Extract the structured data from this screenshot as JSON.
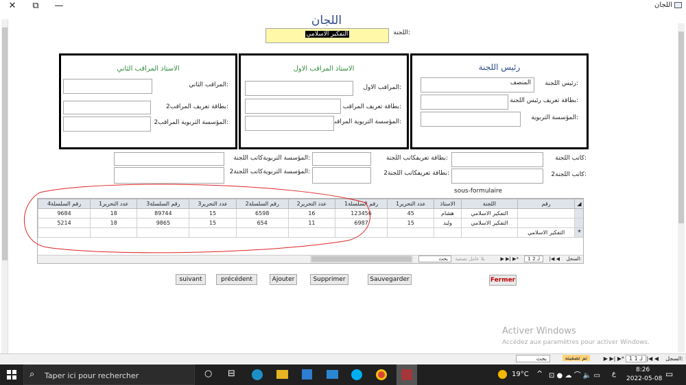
{
  "window": {
    "title": "اللجان",
    "close": "✕",
    "restore": "⧉",
    "minimize": "—"
  },
  "form": {
    "title": "اللجان",
    "committee_label": "اللجنة:",
    "committee_value": "التفكير الاسلامي"
  },
  "president": {
    "header": "رئيس اللجنة",
    "name_label": "رئيس اللجنة:",
    "name_value": "المنصف",
    "card_label": "بطاقة تعريف رئيس اللجنة:",
    "inst_label": "المؤسسة التربوية:"
  },
  "observer1": {
    "header": "الاستاذ المراقب الاول",
    "name_label": "المراقب الاول:",
    "card_label": "بطاقة تعريف المراقب:",
    "inst_label": "المؤسسة التربوية المراقب:"
  },
  "observer2": {
    "header": "الاستاذ المراقب الثاني",
    "name_label": "المراقب الثاني:",
    "card_label": "بطاقة تعريف المراقب2:",
    "inst_label": "المؤسسة التربوية المراقب2:"
  },
  "writers": {
    "w1_label": "كاتب اللجنة:",
    "w1_card_label": "بطاقة تعريفكاتب اللجنة:",
    "w1_inst_label": "المؤسسة التربويةكاتب اللجنة:",
    "w2_label": "كاتب اللجنة2:",
    "w2_card_label": "بطاقة تعريفكاتب اللجنة2:",
    "w2_inst_label": "المؤسسة التربويةكاتب اللجنة2:"
  },
  "subform": {
    "label": "sous-formulaire",
    "columns": [
      "رقم",
      "اللجنة",
      "الاستاذ",
      "عدد التحرير1",
      "رقم السلسلة1",
      "عدد التحرير2",
      "رقم السلسلة2",
      "عدد التحرير3",
      "رقم السلسلة3",
      "عدد التحرير1",
      "رقم السلسلة4"
    ],
    "rows": [
      [
        "",
        "التفكير الاسلامي",
        "هشام",
        "45",
        "123456",
        "16",
        "6598",
        "15",
        "89744",
        "18",
        "9684"
      ],
      [
        "",
        "التفكير الاسلامي",
        "وليد",
        "15",
        "6987",
        "11",
        "654",
        "15",
        "9865",
        "18",
        "5214"
      ],
      [
        "*",
        "التفكير الاسلامي",
        "",
        "",
        "",
        "",
        "",
        "",
        "",
        "",
        ""
      ]
    ],
    "nav_record": "السجل:",
    "nav_pos": "1 لـ 2",
    "nav_filter": "بلا عامل تصفية",
    "nav_search": "بحث"
  },
  "buttons": {
    "next": "suivant",
    "prev": "précédent",
    "add": "Ajouter",
    "delete": "Supprimer",
    "save": "Sauvegarder",
    "close": "Fermer"
  },
  "status": {
    "record": "السجل:",
    "pos": "1 لـ 1",
    "filter": "تم تصفيته",
    "search": "بحث"
  },
  "watermark": {
    "line1": "Activer Windows",
    "line2": "Accédez aux paramètres pour activer Windows."
  },
  "taskbar": {
    "search": "Taper ici pour rechercher",
    "temp": "19°C",
    "time": "8:26",
    "date": "2022-05-08",
    "lang": "ع"
  },
  "colors": {
    "title": "#2b4a8b",
    "header_green": "#2e8b3a",
    "close_red": "#c00000",
    "highlight": "#fff8a8"
  }
}
